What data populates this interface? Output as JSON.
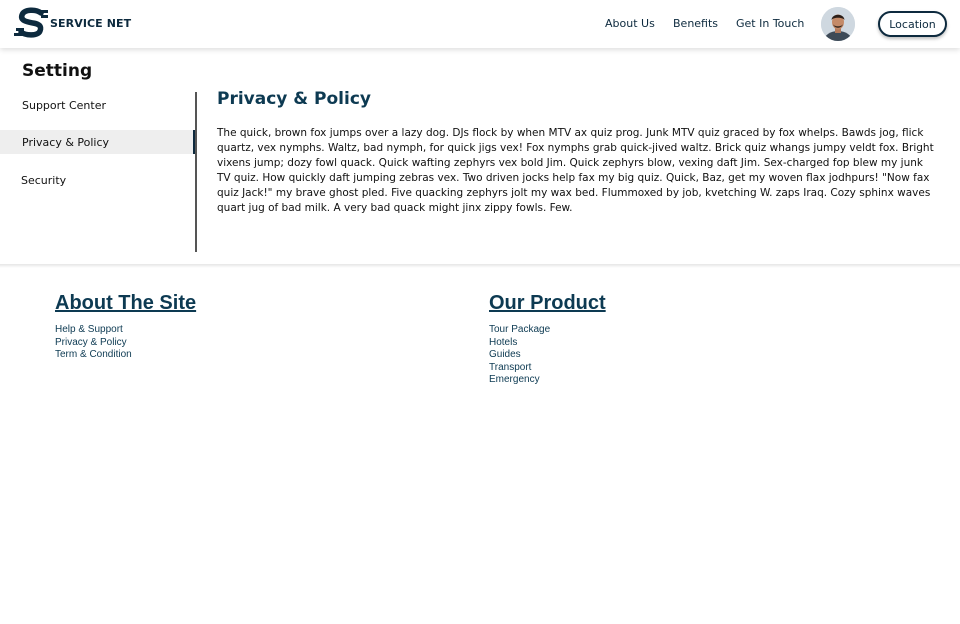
{
  "header": {
    "brand": "SERVICE NET",
    "nav": [
      "About Us",
      "Benefits",
      "Get In Touch"
    ],
    "location_label": "Location"
  },
  "sidebar": {
    "title": "Setting",
    "items": [
      {
        "label": "Support Center",
        "active": false
      },
      {
        "label": "Privacy & Policy",
        "active": true
      },
      {
        "label": "Security",
        "active": false
      }
    ]
  },
  "content": {
    "title": "Privacy & Policy",
    "body": "The quick, brown fox jumps over a lazy dog. DJs flock by when MTV ax quiz prog. Junk MTV quiz graced by fox whelps. Bawds jog, flick quartz, vex nymphs. Waltz, bad nymph, for quick jigs vex! Fox nymphs grab quick-jived waltz. Brick quiz whangs jumpy veldt fox. Bright vixens jump; dozy fowl quack. Quick wafting zephyrs vex bold Jim. Quick zephyrs blow, vexing daft Jim. Sex-charged fop blew my junk TV quiz. How quickly daft jumping zebras vex. Two driven jocks help fax my big quiz. Quick, Baz, get my woven flax jodhpurs! \"Now fax quiz Jack!\" my brave ghost pled. Five quacking zephyrs jolt my wax bed. Flummoxed by job, kvetching W. zaps Iraq. Cozy sphinx waves quart jug of bad milk. A very bad quack might jinx zippy fowls. Few."
  },
  "footer": {
    "about": {
      "heading": "About The Site",
      "links": [
        "Help & Support",
        "Privacy & Policy",
        "Term & Condition"
      ]
    },
    "product": {
      "heading": "Our Product",
      "links": [
        "Tour Package",
        "Hotels",
        "Guides",
        "Transport",
        "Emergency"
      ]
    }
  },
  "colors": {
    "primary": "#0d2a3e",
    "heading": "#0d3a52",
    "active_bg": "#eeeeee"
  },
  "icons": {
    "logo": "service-net-logo",
    "avatar": "user-avatar"
  }
}
